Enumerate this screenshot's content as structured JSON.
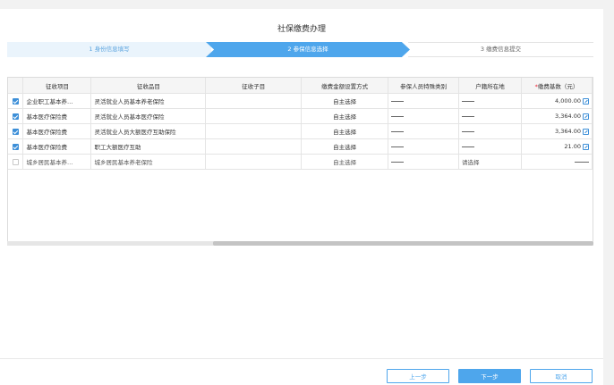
{
  "page": {
    "title": "社保缴费办理"
  },
  "steps": [
    {
      "label": "1 身份信息填写"
    },
    {
      "label": "2 参保信息选择"
    },
    {
      "label": "3 缴费信息提交"
    }
  ],
  "table": {
    "headers": [
      "",
      "征收项目",
      "征收品目",
      "征收子目",
      "缴费金额设置方式",
      "参保人员特殊类别",
      "户籍所在地",
      "缴费基数（元）"
    ],
    "required_mark": "*",
    "rows": [
      {
        "checked": true,
        "item": "企业职工基本养…",
        "category": "灵活就业人员基本养老保险",
        "sub": "",
        "method": "自主选择",
        "special": "",
        "residence": "",
        "base": "4,000.00",
        "editable": true
      },
      {
        "checked": true,
        "item": "基本医疗保险费",
        "category": "灵活就业人员基本医疗保险",
        "sub": "",
        "method": "自主选择",
        "special": "",
        "residence": "",
        "base": "3,364.00",
        "editable": true
      },
      {
        "checked": true,
        "item": "基本医疗保险费",
        "category": "灵活就业人员大额医疗互助保险",
        "sub": "",
        "method": "自主选择",
        "special": "",
        "residence": "",
        "base": "3,364.00",
        "editable": true
      },
      {
        "checked": true,
        "item": "基本医疗保险费",
        "category": "职工大额医疗互助",
        "sub": "",
        "method": "自主选择",
        "special": "",
        "residence": "",
        "base": "21.00",
        "editable": true
      },
      {
        "checked": false,
        "item": "城乡居民基本养…",
        "category": "城乡居民基本养老保险",
        "sub": "",
        "method": "自主选择",
        "special": "",
        "residence": "请选择",
        "base": "",
        "editable": false
      }
    ]
  },
  "buttons": {
    "prev": "上一步",
    "next": "下一步",
    "cancel": "取消"
  },
  "colors": {
    "accent": "#4ea6ec",
    "checkbox": "#3d8fd8"
  }
}
